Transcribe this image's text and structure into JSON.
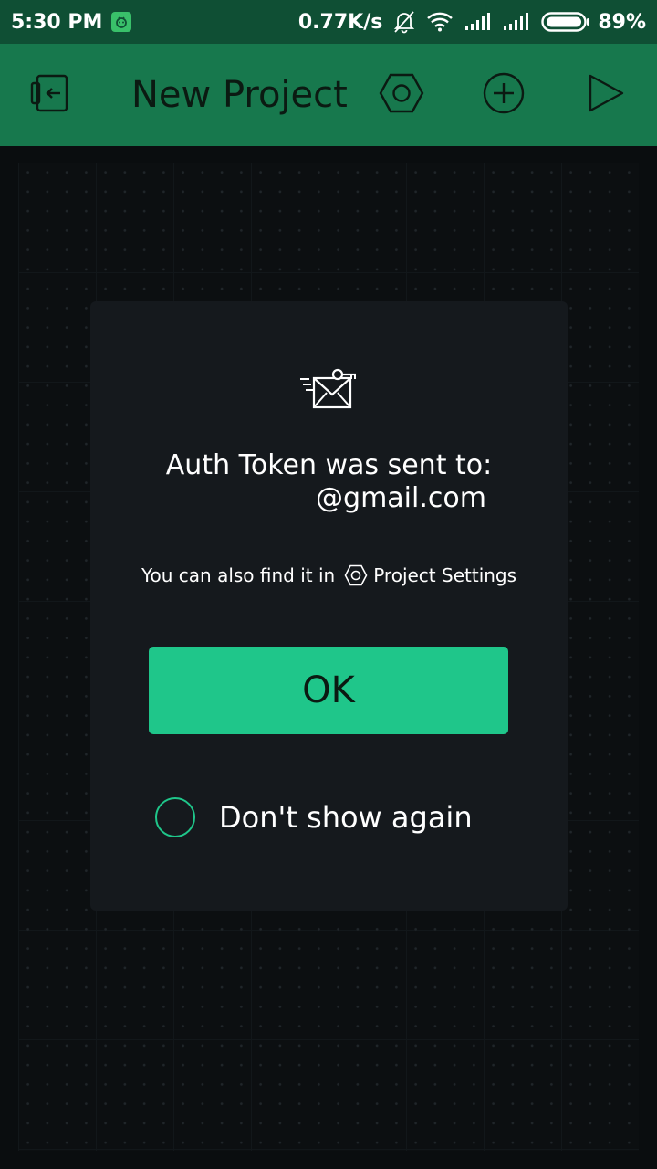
{
  "status_bar": {
    "time": "5:30 PM",
    "network_speed": "0.77K/s",
    "battery_percent": "89%",
    "icons": [
      "app-notification-icon",
      "muted-bell-icon",
      "wifi-icon",
      "signal-icon",
      "signal-icon",
      "battery-icon"
    ]
  },
  "toolbar": {
    "title": "New Project",
    "icons": [
      "exit-icon",
      "settings-hexagon-icon",
      "add-circle-icon",
      "play-icon"
    ]
  },
  "dialog": {
    "title": "Auth Token was sent to:",
    "email": "@gmail.com",
    "hint_prefix": "You can also find it in",
    "hint_link": "Project Settings",
    "ok_label": "OK",
    "dont_show_label": "Don't show again",
    "dont_show_checked": false
  },
  "colors": {
    "status_bar_bg": "#0f4f34",
    "toolbar_bg": "#17784d",
    "accent": "#1fc68a",
    "dialog_bg": "#15191d",
    "canvas_bg": "#0c0f11"
  }
}
